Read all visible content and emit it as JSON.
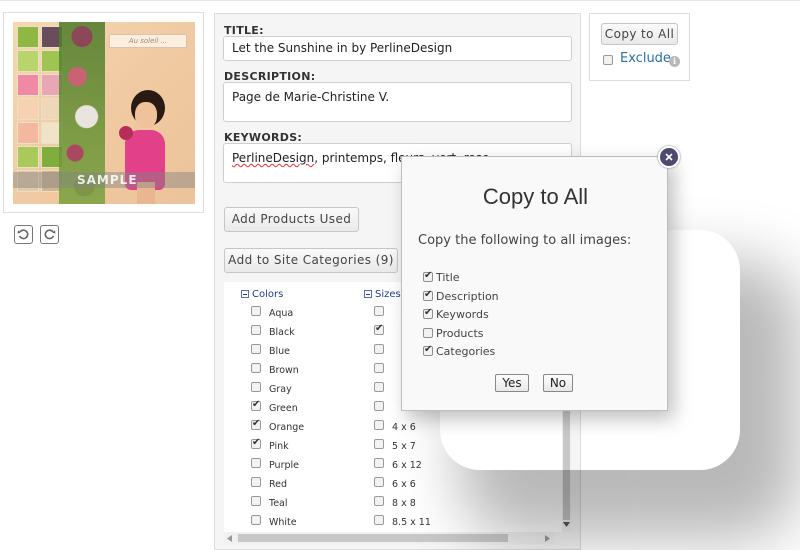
{
  "thumbnail": {
    "tag_text": "Au soleil ...",
    "watermark": "SAMPLE"
  },
  "toolbar": {
    "rotate_left_icon": "rotate-ccw-icon",
    "rotate_right_icon": "rotate-cw-icon"
  },
  "form": {
    "title_label": "TITLE:",
    "title_value": "Let the Sunshine in by PerlineDesign",
    "description_label": "DESCRIPTION:",
    "description_value": "Page de Marie-Christine V.",
    "keywords_label": "KEYWORDS:",
    "keywords_value_underlined": "PerlineDesign",
    "keywords_value_rest": ", printemps, fleurs, vert, rose",
    "add_products_label": "Add Products Used",
    "add_categories_label": "Add to Site Categories (9)"
  },
  "categories": {
    "colors_heading": "Colors",
    "sizes_heading": "Sizes",
    "colors": [
      {
        "label": "Aqua",
        "checked": false
      },
      {
        "label": "Black",
        "checked": false
      },
      {
        "label": "Blue",
        "checked": false
      },
      {
        "label": "Brown",
        "checked": false
      },
      {
        "label": "Gray",
        "checked": false
      },
      {
        "label": "Green",
        "checked": true
      },
      {
        "label": "Orange",
        "checked": true
      },
      {
        "label": "Pink",
        "checked": true
      },
      {
        "label": "Purple",
        "checked": false
      },
      {
        "label": "Red",
        "checked": false
      },
      {
        "label": "Teal",
        "checked": false
      },
      {
        "label": "White",
        "checked": false
      }
    ],
    "sizes": [
      {
        "label": "",
        "checked": false
      },
      {
        "label": "",
        "checked": true
      },
      {
        "label": "",
        "checked": false
      },
      {
        "label": "",
        "checked": false
      },
      {
        "label": "",
        "checked": false
      },
      {
        "label": "",
        "checked": false
      },
      {
        "label": "4 x 6",
        "checked": false
      },
      {
        "label": "5 x 7",
        "checked": false
      },
      {
        "label": "6 x 12",
        "checked": false
      },
      {
        "label": "6 x 6",
        "checked": false
      },
      {
        "label": "8 x 8",
        "checked": false
      },
      {
        "label": "8.5 x 11",
        "checked": false
      }
    ]
  },
  "side": {
    "copy_to_all_label": "Copy to All",
    "exclude_label": "Exclude",
    "info_icon": "info-icon"
  },
  "modal": {
    "title": "Copy to All",
    "prompt": "Copy the following to all images:",
    "options": [
      {
        "label": "Title",
        "checked": true
      },
      {
        "label": "Description",
        "checked": true
      },
      {
        "label": "Keywords",
        "checked": true
      },
      {
        "label": "Products",
        "checked": false
      },
      {
        "label": "Categories",
        "checked": true
      }
    ],
    "yes_label": "Yes",
    "no_label": "No",
    "close_icon": "close-icon"
  },
  "colors": {
    "link_blue": "#2d6e9e",
    "category_heading_blue": "#1f3f8a",
    "close_button": "#4d4a6e"
  }
}
